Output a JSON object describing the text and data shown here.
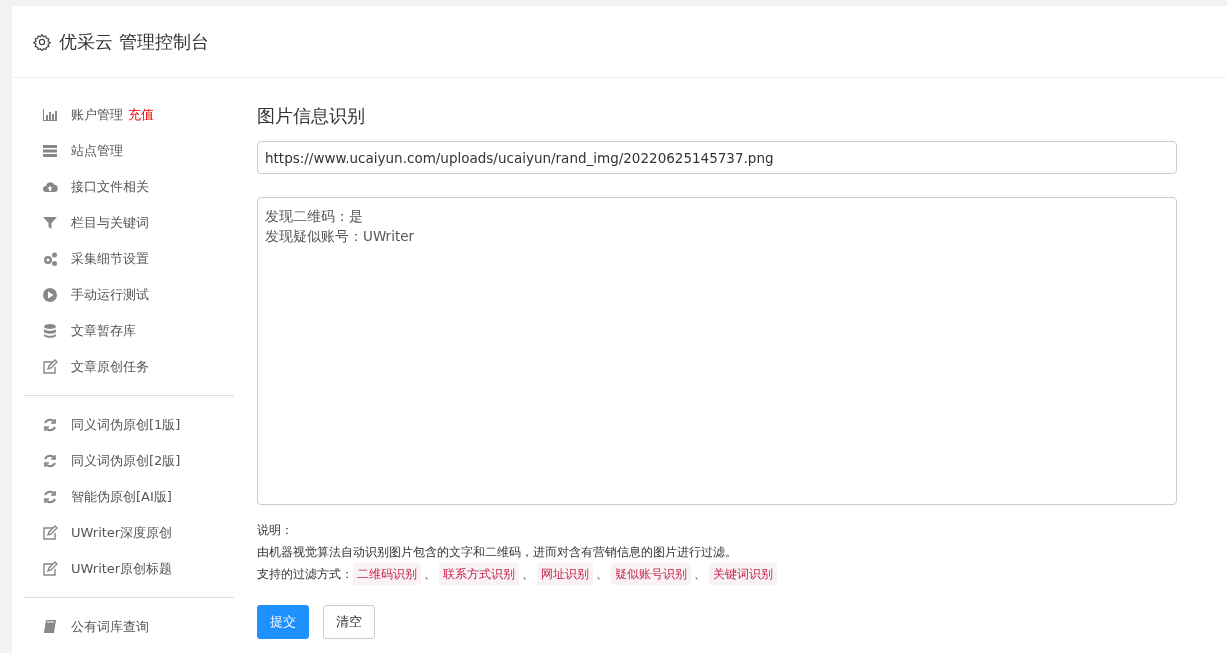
{
  "header": {
    "title": "优采云 管理控制台"
  },
  "sidebar": {
    "groups": [
      {
        "items": [
          {
            "kind": "chart",
            "label": "账户管理",
            "badge": "充值"
          },
          {
            "kind": "server",
            "label": "站点管理"
          },
          {
            "kind": "cloud",
            "label": "接口文件相关"
          },
          {
            "kind": "filter",
            "label": "栏目与关键词"
          },
          {
            "kind": "gears",
            "label": "采集细节设置"
          },
          {
            "kind": "play",
            "label": "手动运行测试"
          },
          {
            "kind": "database",
            "label": "文章暂存库"
          },
          {
            "kind": "edit",
            "label": "文章原创任务"
          }
        ]
      },
      {
        "items": [
          {
            "kind": "refresh",
            "label": "同义词伪原创[1版]"
          },
          {
            "kind": "refresh",
            "label": "同义词伪原创[2版]"
          },
          {
            "kind": "refresh",
            "label": "智能伪原创[AI版]"
          },
          {
            "kind": "edit",
            "label": "UWriter深度原创"
          },
          {
            "kind": "edit",
            "label": "UWriter原创标题"
          }
        ]
      },
      {
        "items": [
          {
            "kind": "book",
            "label": "公有词库查询"
          }
        ]
      }
    ]
  },
  "main": {
    "title": "图片信息识别",
    "url_field": {
      "value": "https://www.ucaiyun.com/uploads/ucaiyun/rand_img/20220625145737.png"
    },
    "result_box": {
      "lines": [
        "发现二维码：是",
        "发现疑似账号：UWriter"
      ]
    },
    "note_label": "说明：",
    "note_text": "由机器视觉算法自动识别图片包含的文字和二维码，进而对含有营销信息的图片进行过滤。",
    "filters_label": "支持的过滤方式：",
    "filters": [
      "二维码识别",
      "联系方式识别",
      "网址识别",
      "疑似账号识别",
      "关键词识别"
    ],
    "separator": "、",
    "buttons": [
      {
        "label": "提交",
        "kind": "primary"
      },
      {
        "label": "清空",
        "kind": "default"
      }
    ]
  }
}
